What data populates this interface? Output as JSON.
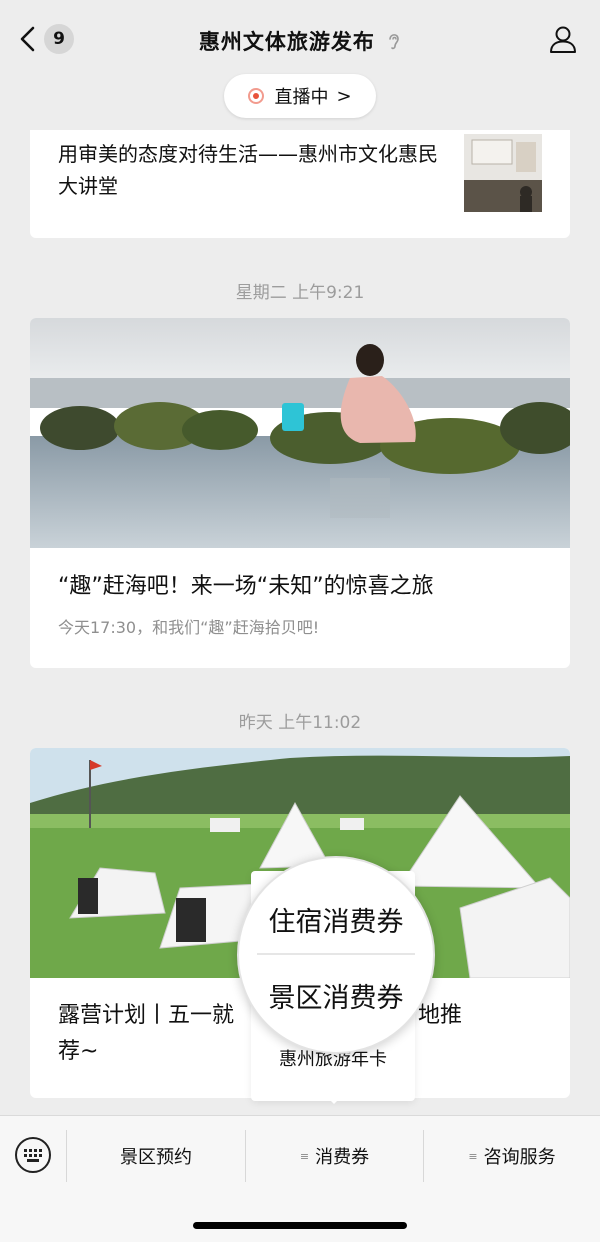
{
  "header": {
    "unread_count": "9",
    "title": "惠州文体旅游发布",
    "live_label": "直播中",
    "live_chevron": ">"
  },
  "articles": [
    {
      "title": "用审美的态度对待生活——惠州市文化惠民大讲堂"
    },
    {
      "timestamp": "星期二 上午9:21",
      "title": "“趣”赶海吧！来一场“未知”的惊喜之旅",
      "subtitle": "今天17:30，和我们“趣”赶海拾贝吧!"
    },
    {
      "timestamp": "昨天 上午11:02",
      "title_left": "露营计划丨五一就",
      "title_right": "藏营地推",
      "title_line2": "荐~"
    }
  ],
  "popup": {
    "items": [
      "住宿消费券",
      "景区消费券",
      "惠州旅游年卡"
    ]
  },
  "menu": {
    "items": [
      "景区预约",
      "消费券",
      "咨询服务"
    ]
  },
  "icons": {
    "back": "chevron-left-icon",
    "profile": "person-icon",
    "ear": "ear-icon",
    "keyboard": "keyboard-icon",
    "menu_lines": "submenu-lines-icon"
  },
  "colors": {
    "background": "#ededed",
    "live_dot": "#e8533b",
    "card": "#ffffff",
    "timestamp": "#9c9c9c"
  }
}
